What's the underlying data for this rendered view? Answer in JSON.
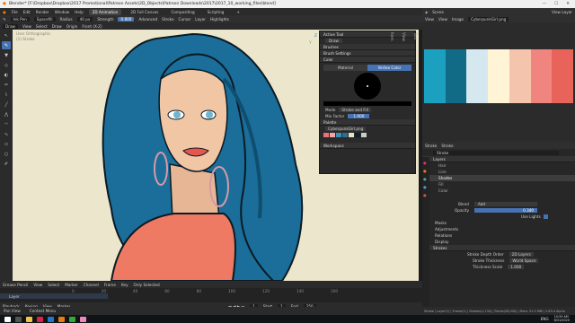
{
  "window": {
    "title": "Blender* [F:\\Dropbox\\Dropbox\\2017 Promotional\\Patreon Assets\\2D_Objects\\Patreon Downloads\\2017\\2017_10_working_files\\blend]"
  },
  "menu": {
    "items": [
      "File",
      "Edit",
      "Render",
      "Window",
      "Help"
    ],
    "workspaces": [
      "2D Animation",
      "2D Full Canvas",
      "Compositing",
      "Scripting",
      "+"
    ],
    "active_workspace": "2D Animation",
    "scene": "Scene",
    "view_layer": "View Layer"
  },
  "tool_header": {
    "brush": "Ink Pen",
    "material": "Spacefill",
    "radius_label": "Radius",
    "radius_value": "40 px",
    "strength_label": "Strength",
    "strength_value": "0.800",
    "advanced": "Advanced",
    "stroke": "Stroke",
    "cursor": "Cursor",
    "layer": "Layer",
    "highlights": "Highlights"
  },
  "view_header": {
    "mode": "Draw",
    "items": [
      "View",
      "Select",
      "Draw"
    ],
    "origin": "Origin",
    "placement": "Front (X-Z)"
  },
  "canvas": {
    "view_label": "User Orthographic",
    "object_label": "(1) Stroke",
    "axis_labels": [
      "Y",
      "X",
      "Z"
    ]
  },
  "sidebar": {
    "active_tool_header": "Active Tool",
    "active_tool": "Draw",
    "brushes": "Brushes",
    "brush_settings": "Brush Settings",
    "color": "Color",
    "color_tabs": [
      "Material",
      "Vertex Color"
    ],
    "mode_label": "Mode",
    "mode_value": "Stroke and Fill",
    "mix_label": "Mix Factor",
    "mix_value": "1.000",
    "palette_header": "Palette",
    "palette_name": "CyberpunkGirl.png",
    "workspace": "Workspace",
    "tabs": [
      "Tool",
      "View",
      "Item",
      "Edit"
    ],
    "swatches": [
      "#e6737a",
      "#f2a6a6",
      "#3a8fb5",
      "#2c6e8e",
      "#e8e2c4",
      "#0f1f2f",
      "#cccccc"
    ]
  },
  "image_editor": {
    "header": [
      "View",
      "View",
      "Image"
    ],
    "image_name": "CyberpunkGirl.png",
    "palette": [
      "#1ca0c0",
      "#116b86",
      "#d5e8f0",
      "#fff5d6",
      "#f5c4ad",
      "#f0847f",
      "#e8645a"
    ]
  },
  "properties": {
    "header": [
      "Stroke",
      "Stroke"
    ],
    "object_name": "Stroke",
    "layers_title": "Layers",
    "layers": [
      "Hair",
      "Line",
      "Shades",
      "Fill",
      "Color"
    ],
    "active_layer": "Shades",
    "blend_label": "Blend",
    "blend_value": "Add",
    "opacity_label": "Opacity",
    "opacity_value": "0.340",
    "use_lights": "Use Lights",
    "sections": [
      "Masks",
      "Adjustments",
      "Relations",
      "Display"
    ],
    "strokes_section": "Strokes",
    "depth_label": "Stroke Depth Order",
    "depth_value": "2D Layers",
    "thickness_label": "Stroke Thickness",
    "thickness_value": "World Space",
    "scale_label": "Thickness Scale",
    "scale_value": "1.000"
  },
  "timeline": {
    "header": [
      "Grease Pencil",
      "View",
      "Select",
      "Marker",
      "Channel",
      "Frame",
      "Key",
      "Only Selected"
    ],
    "playback": [
      "Playback",
      "Keying",
      "View",
      "Marker"
    ],
    "start_label": "Start",
    "start_value": "1",
    "end_label": "End",
    "end_value": "250",
    "current": "1",
    "layer_row": "Layer",
    "numbers": [
      "0",
      "20",
      "40",
      "60",
      "80",
      "100",
      "120",
      "140",
      "160",
      "180",
      "200",
      "220",
      "240"
    ]
  },
  "status": {
    "left": "Pan View",
    "middle": "Context Menu",
    "right": "Stroke | Layer(1) | Frame(1) | Strokes(1,134) | Points(36,000) | Mem: 51.5 MiB | 2.83.0 Alpha"
  },
  "taskbar": {
    "time": "10:59 AM",
    "date": "8/31/2020",
    "lang": "ENG"
  }
}
